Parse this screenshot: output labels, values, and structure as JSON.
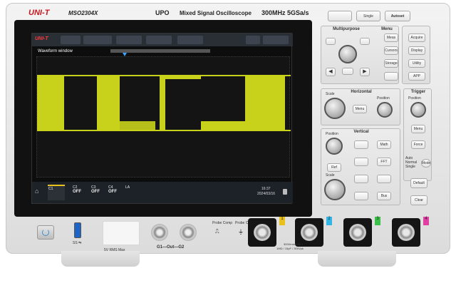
{
  "header": {
    "brand": "UNI-T",
    "model": "MSO2304X",
    "series_logo": "UPO",
    "product": "Mixed Signal Oscilloscope",
    "spec": "300MHz 5GSa/s"
  },
  "top_buttons": {
    "run_stop": "",
    "single": "Single",
    "autoset": "Autoset"
  },
  "screen": {
    "brand": "UNI-T",
    "waveform_window_label": "Waveform window",
    "time_line1": "16:37",
    "time_line2": "2024/03/16",
    "channels": [
      {
        "name": "C1",
        "state": ""
      },
      {
        "name": "C2",
        "state": "OFF"
      },
      {
        "name": "C3",
        "state": "OFF"
      },
      {
        "name": "C4",
        "state": "OFF"
      },
      {
        "name": "LA",
        "state": ""
      }
    ]
  },
  "panels": {
    "multipurpose": "Multipurpose",
    "menu": "Menu",
    "horizontal": "Horizontal",
    "trigger": "Trigger",
    "vertical": "Vertical"
  },
  "menu_buttons": [
    "Meas",
    "Acquire",
    "Cursors",
    "Display",
    "Storage",
    "Utility",
    "",
    "APP"
  ],
  "horizontal": {
    "scale": "Scale",
    "position": "Position",
    "menu": "Menu"
  },
  "trigger": {
    "position": "Position",
    "menu": "Menu",
    "force": "Force",
    "mode_labels": [
      "Auto",
      "Normal",
      "Single"
    ],
    "mode": "Mode"
  },
  "vertical": {
    "position": "Position",
    "scale": "Scale",
    "math": "Math",
    "ref": "Ref",
    "fft": "FFT",
    "bus": "Bus"
  },
  "right_column": {
    "default": "Default",
    "clear": "Clear"
  },
  "front": {
    "usb_label": "SS",
    "spec_label": "5V RMS Max",
    "gen_label_left": "G1",
    "gen_label_mid": "Out",
    "gen_label_right": "G2",
    "probe1": "Probe Comp",
    "probe2": "Probe Comp",
    "channel_warning": "300Vrms CAT I",
    "channel_spec": "1MΩ / 15pF / 300Vpk",
    "channel_numbers": [
      "1",
      "2",
      "3",
      "4"
    ]
  },
  "colors": {
    "brand_red": "#c8161d",
    "ch1": "#e8c21a",
    "ch2": "#33b6e5",
    "ch3": "#3cc04a",
    "ch4": "#e23fa3",
    "trace": "#c9d21b"
  },
  "icons": [
    "power-icon",
    "usb-icon",
    "home-icon",
    "arrow-left-icon",
    "arrow-right-icon",
    "arrow-up-icon",
    "arrow-down-icon",
    "lock-icon",
    "square-wave-icon",
    "ground-icon"
  ]
}
